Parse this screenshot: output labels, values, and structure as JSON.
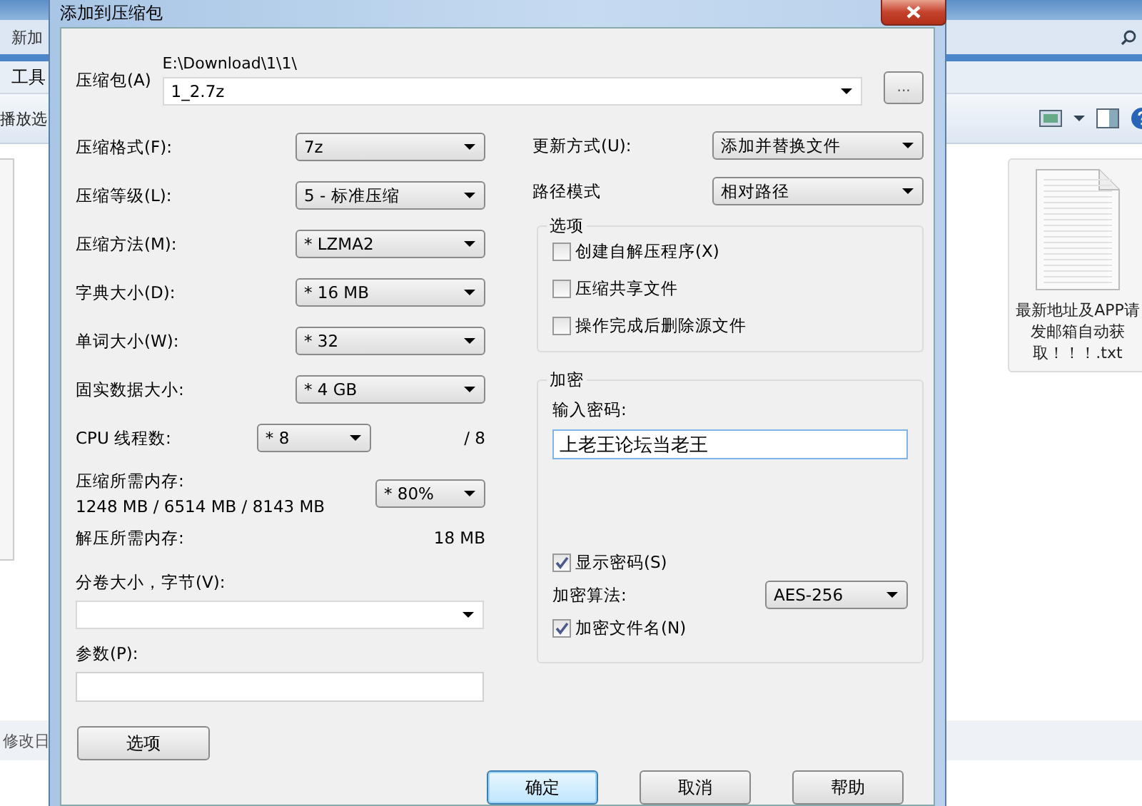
{
  "explorer": {
    "address": "新加",
    "menu": "工具",
    "toolbar_item": "播放选",
    "column_header": "修改日",
    "file": {
      "name": "最新地址及APP请发邮箱自动获取！！！.txt"
    }
  },
  "dialog": {
    "title": "添加到压缩包",
    "archive": {
      "label": "压缩包(A)",
      "path": "E:\\Download\\1\\1\\",
      "value": "1_2.7z",
      "browse": "..."
    },
    "settings": [
      {
        "label": "压缩格式(F):",
        "value": "7z"
      },
      {
        "label": "压缩等级(L):",
        "value": "5 - 标准压缩"
      },
      {
        "label": "压缩方法(M):",
        "value": "* LZMA2"
      },
      {
        "label": "字典大小(D):",
        "value": "* 16 MB"
      },
      {
        "label": "单词大小(W):",
        "value": "* 32"
      },
      {
        "label": "固实数据大小:",
        "value": "* 4 GB"
      }
    ],
    "cpu_threads": {
      "label": "CPU 线程数:",
      "value": "* 8",
      "total": "/ 8"
    },
    "compress_memory": {
      "label": "压缩所需内存:",
      "detail": "1248 MB / 6514 MB / 8143 MB",
      "value": "* 80%"
    },
    "decompress_memory": {
      "label": "解压所需内存:",
      "value": "18 MB"
    },
    "volume_size": {
      "label": "分卷大小，字节(V):"
    },
    "parameters": {
      "label": "参数(P):"
    },
    "options_button": "选项",
    "update_mode": {
      "label": "更新方式(U):",
      "value": "添加并替换文件"
    },
    "path_mode": {
      "label": "路径模式",
      "value": "相对路径"
    },
    "options": {
      "title": "选项",
      "checkboxes": [
        {
          "label": "创建自解压程序(X)",
          "checked": false
        },
        {
          "label": "压缩共享文件",
          "checked": false
        },
        {
          "label": "操作完成后删除源文件",
          "checked": false
        }
      ]
    },
    "encryption": {
      "title": "加密",
      "password_label": "输入密码:",
      "password": "上老王论坛当老王",
      "show_password": {
        "label": "显示密码(S)",
        "checked": true
      },
      "method_label": "加密算法:",
      "method": "AES-256",
      "encrypt_names": {
        "label": "加密文件名(N)",
        "checked": true
      }
    },
    "buttons": [
      {
        "label": "确定",
        "default": true
      },
      {
        "label": "取消",
        "default": false
      },
      {
        "label": "帮助",
        "default": false
      }
    ]
  }
}
